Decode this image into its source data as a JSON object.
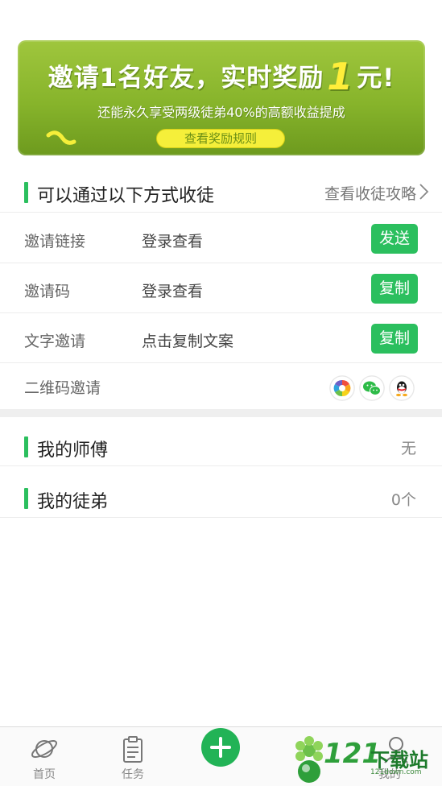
{
  "banner": {
    "title_before": "邀请1名好友，实时奖励",
    "title_num": "1",
    "title_after": "元!",
    "subtitle": "还能永久享受两级徒弟40%的高额收益提成",
    "rules_button": "查看奖励规则"
  },
  "invite_section": {
    "title": "可以通过以下方式收徒",
    "guide_link": "查看收徒攻略",
    "rows": [
      {
        "label": "邀请链接",
        "value": "登录查看",
        "button": "发送"
      },
      {
        "label": "邀请码",
        "value": "登录查看",
        "button": "复制"
      },
      {
        "label": "文字邀请",
        "value": "点击复制文案",
        "button": "复制"
      },
      {
        "label": "二维码邀请",
        "value": "",
        "button": ""
      }
    ],
    "share_icons": [
      "moments-icon",
      "wechat-icon",
      "qq-icon"
    ]
  },
  "master": {
    "title": "我的师傅",
    "value": "无"
  },
  "apprentice": {
    "title": "我的徒弟",
    "value": "0个"
  },
  "tabbar": {
    "home": "首页",
    "tasks": "任务",
    "add": "+",
    "mine": "我的"
  },
  "watermark": {
    "brand": "121",
    "text": "下载站",
    "url": "121down.com"
  },
  "colors": {
    "accent": "#2bbf5e",
    "banner": "#8cbb2f",
    "highlight": "#ffee3a"
  }
}
